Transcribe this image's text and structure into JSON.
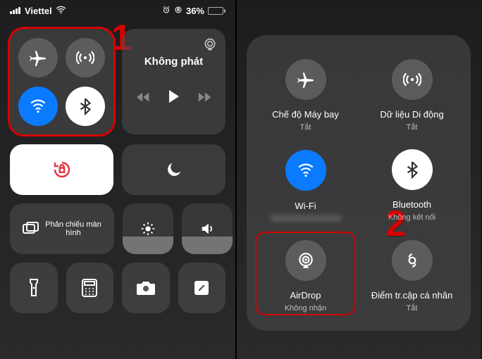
{
  "status": {
    "carrier": "Viettel",
    "battery_pct": "36%"
  },
  "music": {
    "title": "Không phát"
  },
  "mirror_label": "Phản chiếu màn hình",
  "callouts": {
    "one": "1",
    "two": "2"
  },
  "expanded": {
    "airplane": {
      "title": "Chế độ Máy bay",
      "sub": "Tắt"
    },
    "cellular": {
      "title": "Dữ liệu Di động",
      "sub": "Tắt"
    },
    "wifi": {
      "title": "Wi-Fi",
      "sub": ""
    },
    "bluetooth": {
      "title": "Bluetooth",
      "sub": "Không kết nối"
    },
    "airdrop": {
      "title": "AirDrop",
      "sub": "Không nhận"
    },
    "hotspot": {
      "title": "Điểm tr.cập cá nhân",
      "sub": "Tắt"
    }
  }
}
